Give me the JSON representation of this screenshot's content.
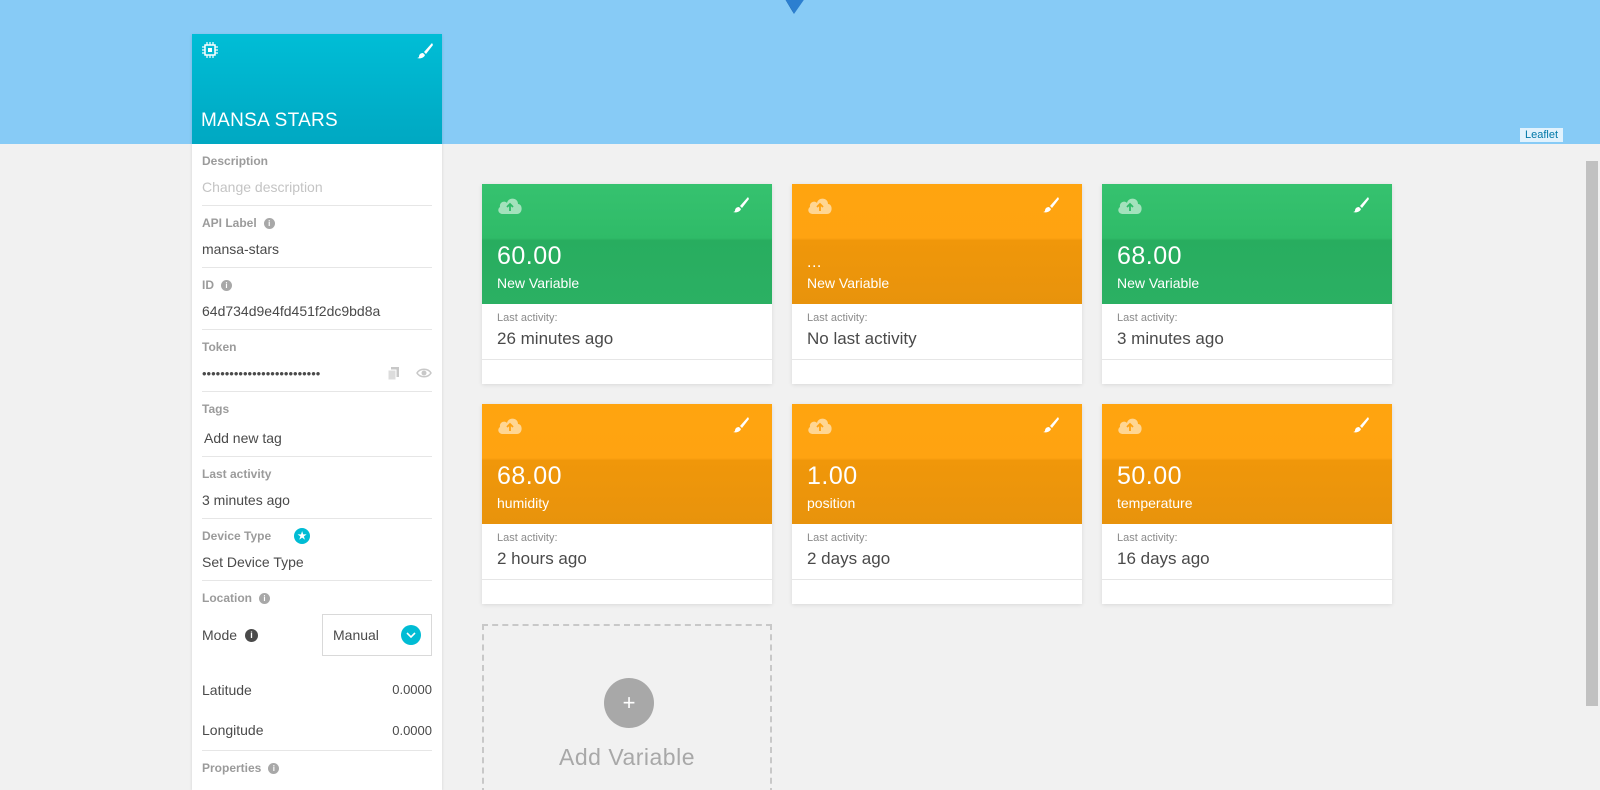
{
  "map": {
    "attribution": "Leaflet"
  },
  "device": {
    "name": "MANSA STARS",
    "description": {
      "label": "Description",
      "placeholder": "Change description"
    },
    "api_label": {
      "label": "API Label",
      "value": "mansa-stars"
    },
    "id": {
      "label": "ID",
      "value": "64d734d9e4fd451f2dc9bd8a"
    },
    "token": {
      "label": "Token",
      "value": "••••••••••••••••••••••••••"
    },
    "tags": {
      "label": "Tags",
      "placeholder": "Add new tag"
    },
    "last_activity": {
      "label": "Last activity",
      "value": "3 minutes ago"
    },
    "device_type": {
      "label": "Device Type",
      "value": "Set Device Type"
    },
    "location": {
      "label": "Location",
      "mode_label": "Mode",
      "mode_value": "Manual",
      "latitude_label": "Latitude",
      "latitude_value": "0.0000",
      "longitude_label": "Longitude",
      "longitude_value": "0.0000"
    },
    "properties": {
      "label": "Properties"
    }
  },
  "variables": [
    {
      "value": "60.00",
      "name": "New Variable",
      "last_activity_label": "Last activity:",
      "last_activity": "26 minutes ago",
      "color": "#2fbb68"
    },
    {
      "value": "...",
      "name": "New Variable",
      "last_activity_label": "Last activity:",
      "last_activity": "No last activity",
      "color": "#ffa311"
    },
    {
      "value": "68.00",
      "name": "New Variable",
      "last_activity_label": "Last activity:",
      "last_activity": "3 minutes ago",
      "color": "#2fbb68"
    },
    {
      "value": "68.00",
      "name": "humidity",
      "last_activity_label": "Last activity:",
      "last_activity": "2 hours ago",
      "color": "#ffa311"
    },
    {
      "value": "1.00",
      "name": "position",
      "last_activity_label": "Last activity:",
      "last_activity": "2 days ago",
      "color": "#ffa311"
    },
    {
      "value": "50.00",
      "name": "temperature",
      "last_activity_label": "Last activity:",
      "last_activity": "16 days ago",
      "color": "#ffa311"
    }
  ],
  "add_variable": {
    "label": "Add Variable",
    "icon_text": "+"
  },
  "colors": {
    "accent": "#00bcd4",
    "green": "#2fbb68",
    "orange": "#ffa311",
    "map": "#87cbf6"
  }
}
